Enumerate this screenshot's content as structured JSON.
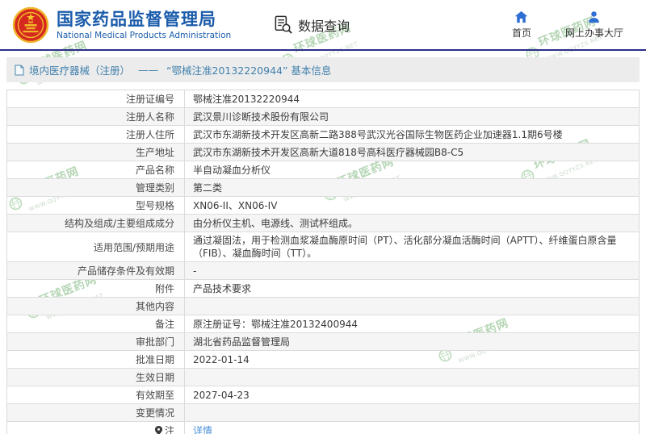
{
  "header": {
    "agency_name_cn": "国家药品监督管理局",
    "agency_name_en": "National Medical Products Administration",
    "nav_data_query": "数据查询",
    "nav_home": "首页",
    "nav_service_hall": "网上办事大厅"
  },
  "breadcrumb": {
    "category": "境内医疗器械（注册）",
    "separator": "——",
    "title": "“鄂械注准20132220944” 基本信息"
  },
  "table": {
    "rows": [
      {
        "label": "注册证编号",
        "value": "鄂械注准20132220944"
      },
      {
        "label": "注册人名称",
        "value": "武汉景川诊断技术股份有限公司"
      },
      {
        "label": "注册人住所",
        "value": "武汉市东湖新技术开发区高新二路388号武汉光谷国际生物医药企业加速器1.1期6号楼"
      },
      {
        "label": "生产地址",
        "value": "武汉市东湖新技术开发区高新大道818号高科医疗器械园B8-C5"
      },
      {
        "label": "产品名称",
        "value": "半自动凝血分析仪"
      },
      {
        "label": "管理类别",
        "value": "第二类"
      },
      {
        "label": "型号规格",
        "value": "XN06-II、XN06-IV"
      },
      {
        "label": "结构及组成/主要组成成分",
        "value": "由分析仪主机、电源线、测试杯组成。"
      },
      {
        "label": "适用范围/预期用途",
        "value": "通过凝固法，用于检测血浆凝血酶原时间（PT）、活化部分凝血活酶时间（APTT）、纤维蛋白原含量（FIB）、凝血酶时间（TT）。"
      },
      {
        "label": "产品储存条件及有效期",
        "value": "-"
      },
      {
        "label": "附件",
        "value": "产品技术要求"
      },
      {
        "label": "其他内容",
        "value": ""
      },
      {
        "label": "备注",
        "value": "原注册证号：鄂械注准20132400944"
      },
      {
        "label": "审批部门",
        "value": "湖北省药品监督管理局"
      },
      {
        "label": "批准日期",
        "value": "2022-01-14"
      },
      {
        "label": "生效日期",
        "value": ""
      },
      {
        "label": "有效期至",
        "value": "2027-04-23"
      },
      {
        "label": "变更情况",
        "value": ""
      },
      {
        "label": "注",
        "value": "详情",
        "link": true,
        "pin_icon": true
      }
    ]
  },
  "watermark": {
    "text": "环球医药网",
    "url": "WWW.QQYYZS.NET"
  },
  "colors": {
    "brand_blue": "#1b5cab",
    "nav_icon_blue": "#2f6fd3",
    "divider_navy": "#2c2f88",
    "breadcrumb_text": "#4180ac",
    "link_blue": "#4a90d9",
    "watermark_green": "#6fae6f",
    "row_alt_bg": "#f5f5f5"
  }
}
